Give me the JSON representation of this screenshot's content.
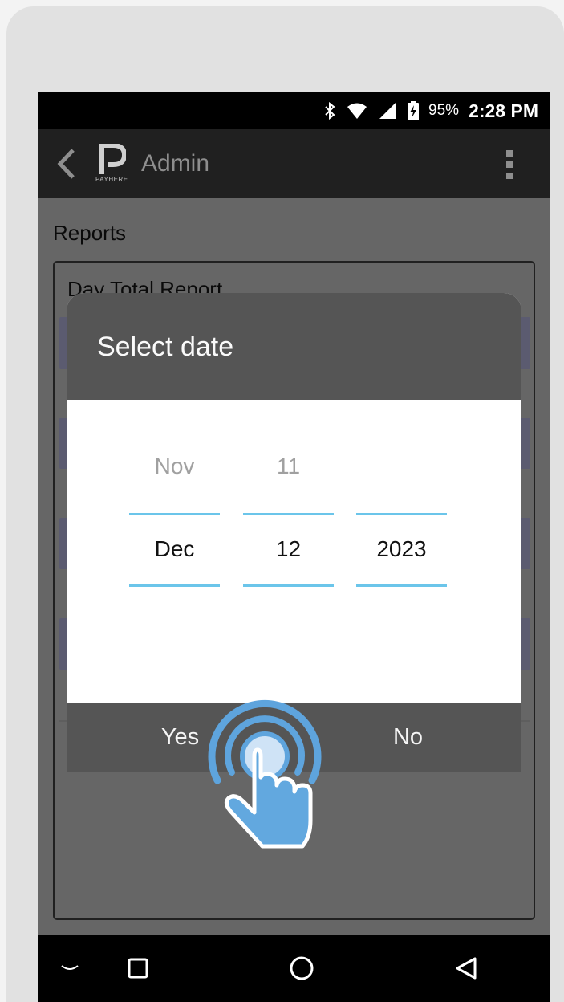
{
  "status_bar": {
    "icons": [
      "bluetooth-icon",
      "wifi-icon",
      "cell-signal-icon",
      "battery-charging-icon"
    ],
    "battery_percent": "95%",
    "time": "2:28 PM"
  },
  "app_bar": {
    "logo_text": "PAYHERE",
    "title": "Admin"
  },
  "page": {
    "section_title": "Reports",
    "card_title": "Day Total Report"
  },
  "dialog": {
    "title": "Select date",
    "picker": {
      "month": {
        "previous": "Nov",
        "selected": "Dec"
      },
      "day": {
        "previous": "11",
        "selected": "12"
      },
      "year": {
        "previous": "",
        "selected": "2023"
      }
    },
    "confirm_label": "Yes",
    "cancel_label": "No"
  },
  "nav_bar": {
    "icons": [
      "hide-keyboard-icon",
      "recents-icon",
      "home-icon",
      "back-icon"
    ]
  },
  "colors": {
    "picker_line": "#6bc5ea",
    "dialog_header": "#555555",
    "tap_hint": "#5ea4dd"
  }
}
